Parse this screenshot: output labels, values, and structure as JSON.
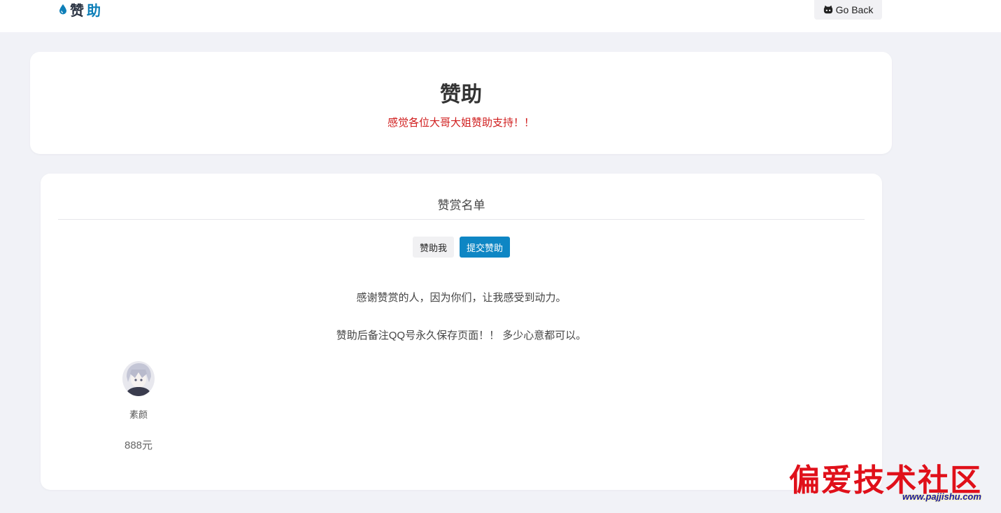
{
  "header": {
    "brand_first": "赞",
    "brand_second": "助",
    "go_back": "Go Back"
  },
  "intro": {
    "title": "赞助",
    "subtitle": "感觉各位大哥大姐赞助支持！！"
  },
  "sponsor_list": {
    "title": "赞赏名单",
    "buttons": {
      "sponsor_me": "赞助我",
      "submit": "提交赞助"
    },
    "thanks_text": "感谢赞赏的人，因为你们，让我感受到动力。",
    "note_text": "赞助后备注QQ号永久保存页面！！ 多少心意都可以。",
    "sponsors": [
      {
        "name": "素颜",
        "amount": "888元"
      }
    ]
  },
  "watermark": {
    "text": "偏爱技术社区",
    "url": "www.pajjishu.com"
  },
  "colors": {
    "accent": "#0e86c4",
    "subtitle_red": "#d01d1d",
    "background": "#f1f2f7"
  },
  "icons": {
    "brand": "water-drop-icon",
    "go_back": "github-icon"
  }
}
